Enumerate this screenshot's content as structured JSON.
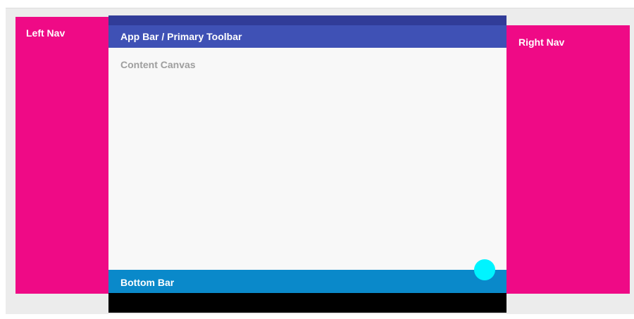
{
  "left_nav": {
    "label": "Left Nav"
  },
  "right_nav": {
    "label": "Right Nav"
  },
  "app_bar": {
    "label": "App Bar / Primary Toolbar"
  },
  "content": {
    "label": "Content Canvas"
  },
  "bottom_bar": {
    "label": "Bottom Bar"
  },
  "colors": {
    "nav": "#ef0a86",
    "status_bar": "#313c98",
    "app_bar": "#3f51b5",
    "content_canvas": "#f8f8f8",
    "bottom_bar": "#0a89ca",
    "system_nav_bar": "#000000",
    "fab": "#00f4ff",
    "background": "#ececec"
  }
}
